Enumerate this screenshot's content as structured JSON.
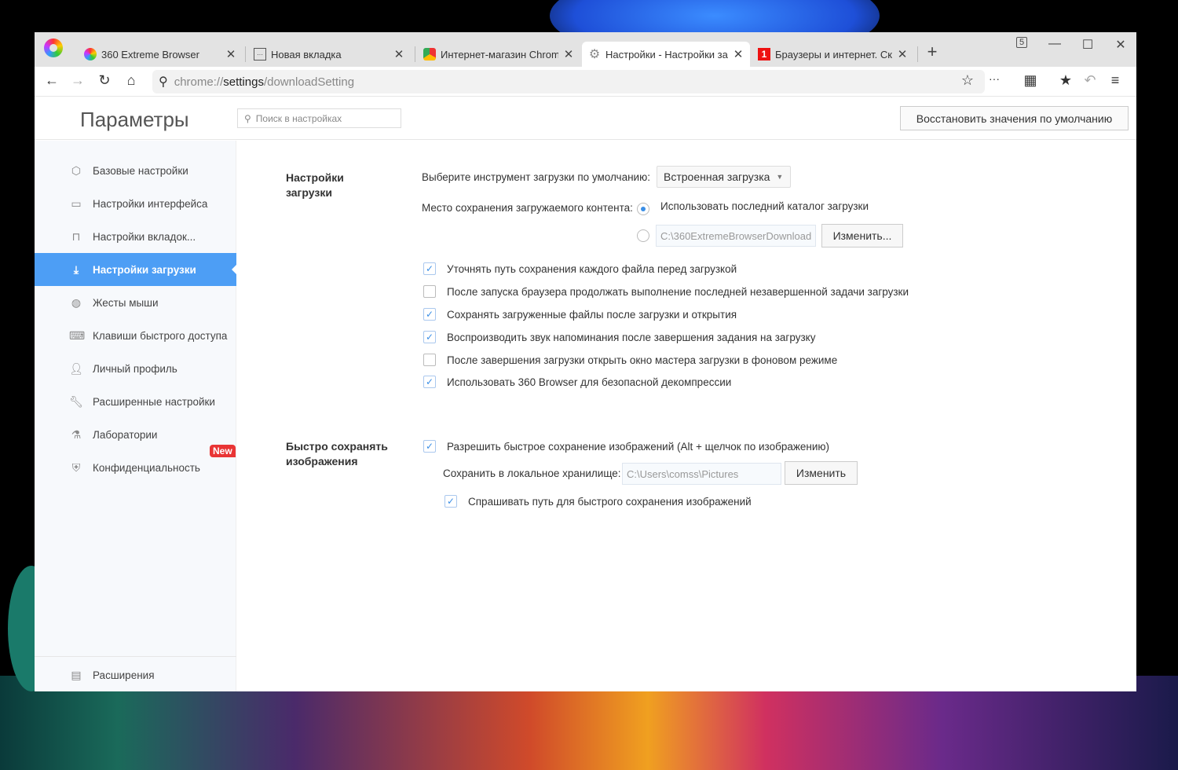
{
  "tabs": [
    {
      "title": "360 Extreme Browser",
      "icon": "360-logo-icon"
    },
    {
      "title": "Новая вкладка",
      "icon": "new-tab-icon"
    },
    {
      "title": "Интернет-магазин Chrome",
      "icon": "chrome-store-icon"
    },
    {
      "title": "Настройки - Настройки загрузки",
      "icon": "gear-icon",
      "active": true
    },
    {
      "title": "Браузеры и интернет. Скачать",
      "icon": "site-1-icon"
    }
  ],
  "tab_count": "5",
  "address": {
    "prefix": "chrome://",
    "host": "settings",
    "path": "/downloadSetting"
  },
  "header": {
    "title": "Параметры",
    "search_placeholder": "Поиск в настройках",
    "reset": "Восстановить значения по умолчанию"
  },
  "sidebar": {
    "items": [
      {
        "label": "Базовые настройки",
        "icon": "hexagon-icon"
      },
      {
        "label": "Настройки интерфейса",
        "icon": "window-icon"
      },
      {
        "label": "Настройки вкладок...",
        "icon": "tab-icon"
      },
      {
        "label": "Настройки загрузки",
        "icon": "download-icon",
        "active": true
      },
      {
        "label": "Жесты мыши",
        "icon": "mouse-icon"
      },
      {
        "label": "Клавиши быстрого доступа",
        "icon": "keyboard-icon"
      },
      {
        "label": "Личный профиль",
        "icon": "user-icon"
      },
      {
        "label": "Расширенные настройки",
        "icon": "wrench-icon"
      },
      {
        "label": "Лаборатории",
        "icon": "flask-icon"
      },
      {
        "label": "Конфиденциальность",
        "icon": "shield-icon"
      }
    ],
    "new_badge": "New",
    "footer": "Расширения"
  },
  "download": {
    "title": "Настройки загрузки",
    "tool_label": "Выберите инструмент загрузки по умолчанию:",
    "tool_value": "Встроенная загрузка",
    "location_label": "Место сохранения загружаемого контента:",
    "option_last": "Использовать последний каталог загрузки",
    "path": "C:\\360ExtremeBrowserDownload",
    "change": "Изменить...",
    "checkboxes": [
      {
        "label": "Уточнять путь сохранения каждого файла перед загрузкой",
        "checked": true
      },
      {
        "label": "После запуска браузера продолжать выполнение последней незавершенной задачи загрузки",
        "checked": false
      },
      {
        "label": "Сохранять загруженные файлы после загрузки и открытия",
        "checked": true
      },
      {
        "label": "Воспроизводить звук напоминания после завершения задания на загрузку",
        "checked": true
      },
      {
        "label": "После завершения загрузки открыть окно мастера загрузки в фоновом режиме",
        "checked": false
      },
      {
        "label": "Использовать 360 Browser для безопасной декомпрессии",
        "checked": true
      }
    ]
  },
  "images": {
    "title": "Быстро сохранять изображения",
    "allow": "Разрешить быстрое сохранение изображений (Alt + щелчок по изображению)",
    "local_label": "Сохранить в локальное хранилище:",
    "path": "C:\\Users\\comss\\Pictures",
    "change": "Изменить",
    "ask": "Спрашивать путь для быстрого сохранения изображений"
  },
  "colors": {
    "accent": "#4d9ef5",
    "badge": "#e93535"
  }
}
